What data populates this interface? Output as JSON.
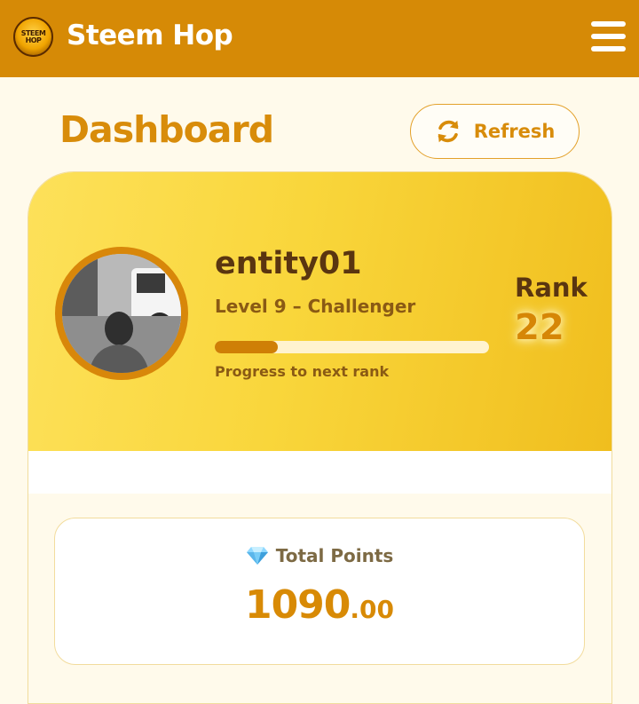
{
  "app": {
    "title": "Steem Hop",
    "logo_text": "STEEM HOP",
    "icons": [
      "menu-icon",
      "refresh-icon",
      "gem-icon"
    ]
  },
  "header": {
    "page_title": "Dashboard",
    "refresh_label": "Refresh"
  },
  "profile": {
    "username": "entity01",
    "level": "Level 9 – Challenger",
    "progress_label": "Progress to next rank",
    "progress": 0.23,
    "rank_label": "Rank",
    "rank_value": "22"
  },
  "points": {
    "label": "Total Points",
    "value_int": "1090",
    "value_dec": ".00"
  },
  "colors": {
    "brand": "#d68a06",
    "accent_text": "#d88c0a",
    "hero_gradient_start": "#fde15a",
    "hero_gradient_end": "#f0be1e",
    "background": "#fffaeb"
  }
}
